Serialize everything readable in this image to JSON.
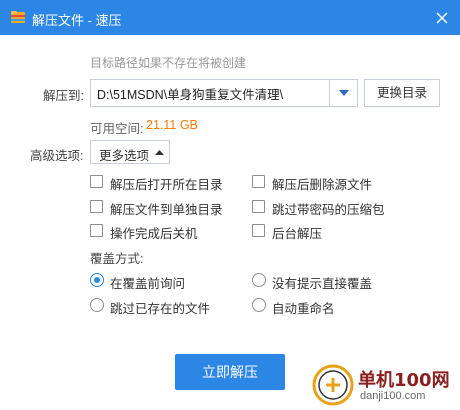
{
  "window": {
    "title": "解压文件 - 速压",
    "app_icon": "zip-folder-icon",
    "close_icon": "close-icon",
    "titlebar_color": "#2b86e6"
  },
  "destination": {
    "hint": "目标路径如果不存在将被创建",
    "label": "解压到:",
    "path_value": "D:\\51MSDN\\单身狗重复文件清理\\",
    "change_button": "更换目录",
    "space_label": "可用空间:",
    "space_value": "21.11 GB",
    "space_value_color": "#ff7a00"
  },
  "advanced": {
    "label": "高级选项:",
    "more_button": "更多选项",
    "options": [
      {
        "label": "解压后打开所在目录",
        "checked": false
      },
      {
        "label": "解压后删除源文件",
        "checked": false
      },
      {
        "label": "解压文件到单独目录",
        "checked": false
      },
      {
        "label": "跳过带密码的压缩包",
        "checked": false
      },
      {
        "label": "操作完成后关机",
        "checked": false
      },
      {
        "label": "后台解压",
        "checked": false
      }
    ]
  },
  "overwrite": {
    "label": "覆盖方式:",
    "options": [
      {
        "label": "在覆盖前询问",
        "selected": true
      },
      {
        "label": "没有提示直接覆盖",
        "selected": false
      },
      {
        "label": "跳过已存在的文件",
        "selected": false
      },
      {
        "label": "自动重命名",
        "selected": false
      }
    ]
  },
  "action": {
    "primary_button": "立即解压",
    "primary_color": "#2b86e6"
  },
  "watermark": {
    "site_name": "单机100网",
    "site_url": "danji100.com"
  }
}
